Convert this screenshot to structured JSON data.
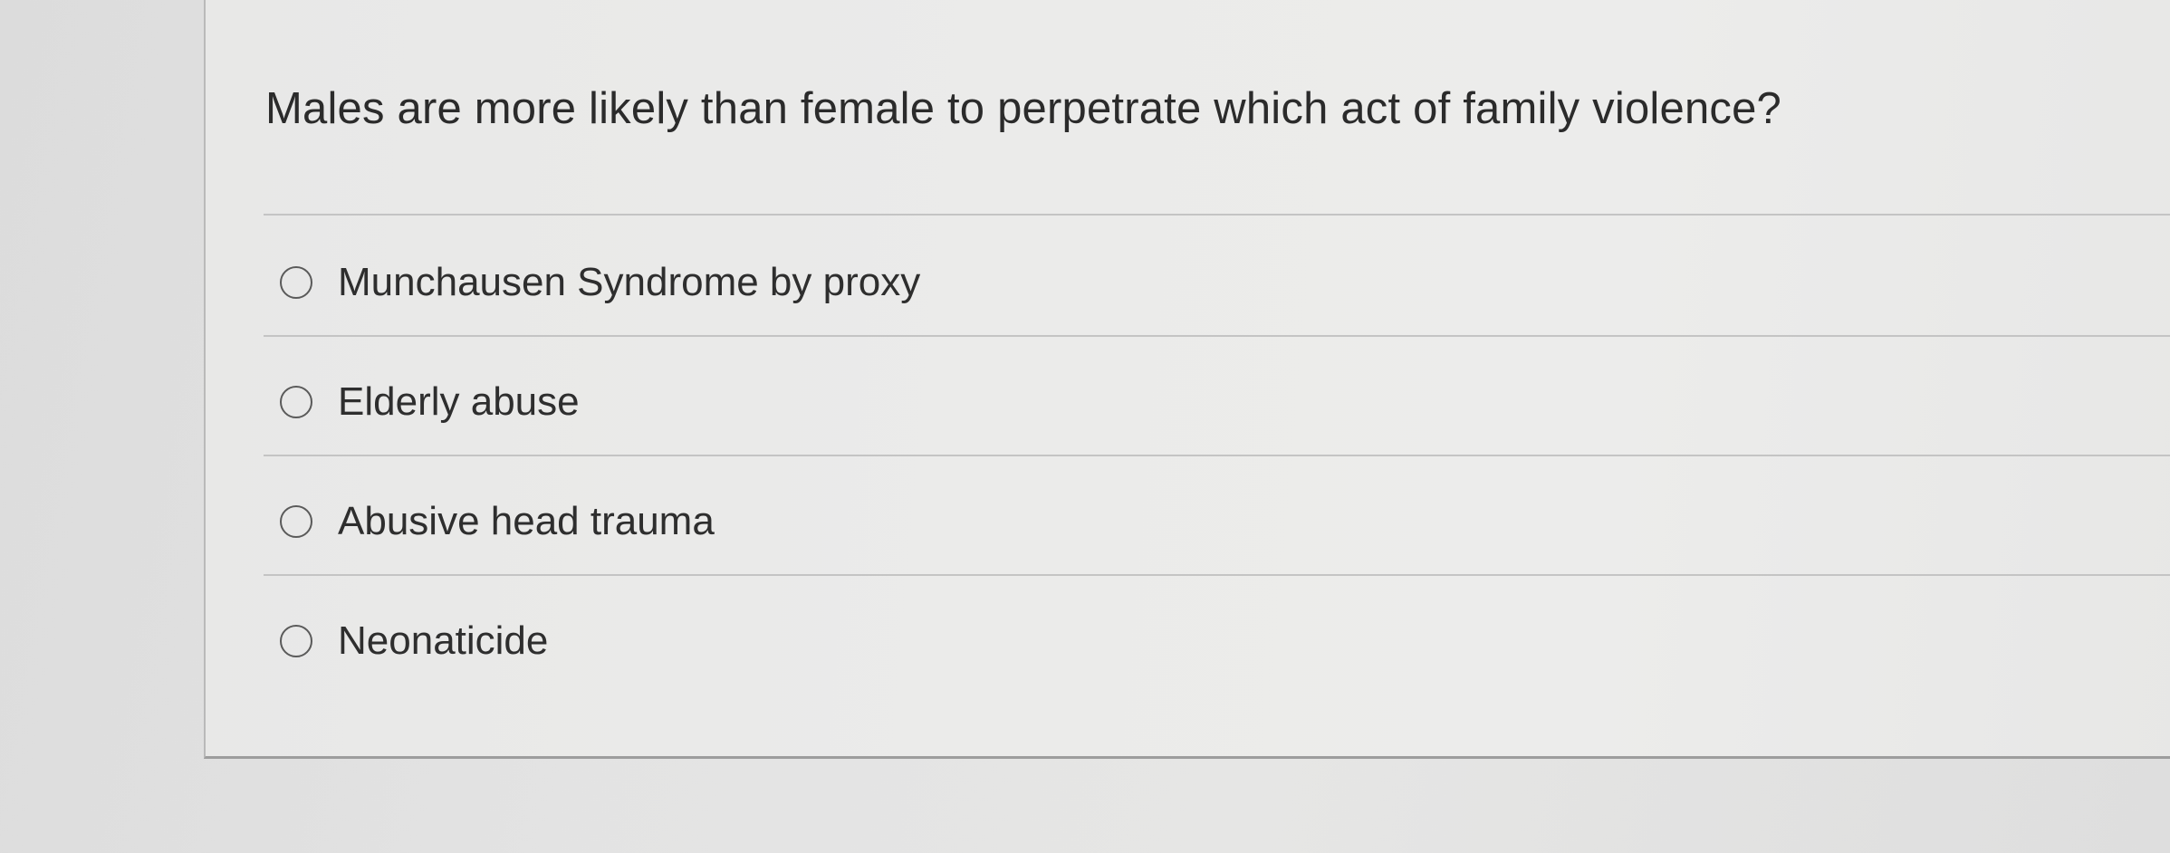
{
  "question": {
    "text": "Males are more likely than female to perpetrate which act of family violence?"
  },
  "options": [
    {
      "label": "Munchausen Syndrome by proxy",
      "selected": false
    },
    {
      "label": "Elderly abuse",
      "selected": false
    },
    {
      "label": "Abusive head trauma",
      "selected": false
    },
    {
      "label": "Neonaticide",
      "selected": false
    }
  ]
}
